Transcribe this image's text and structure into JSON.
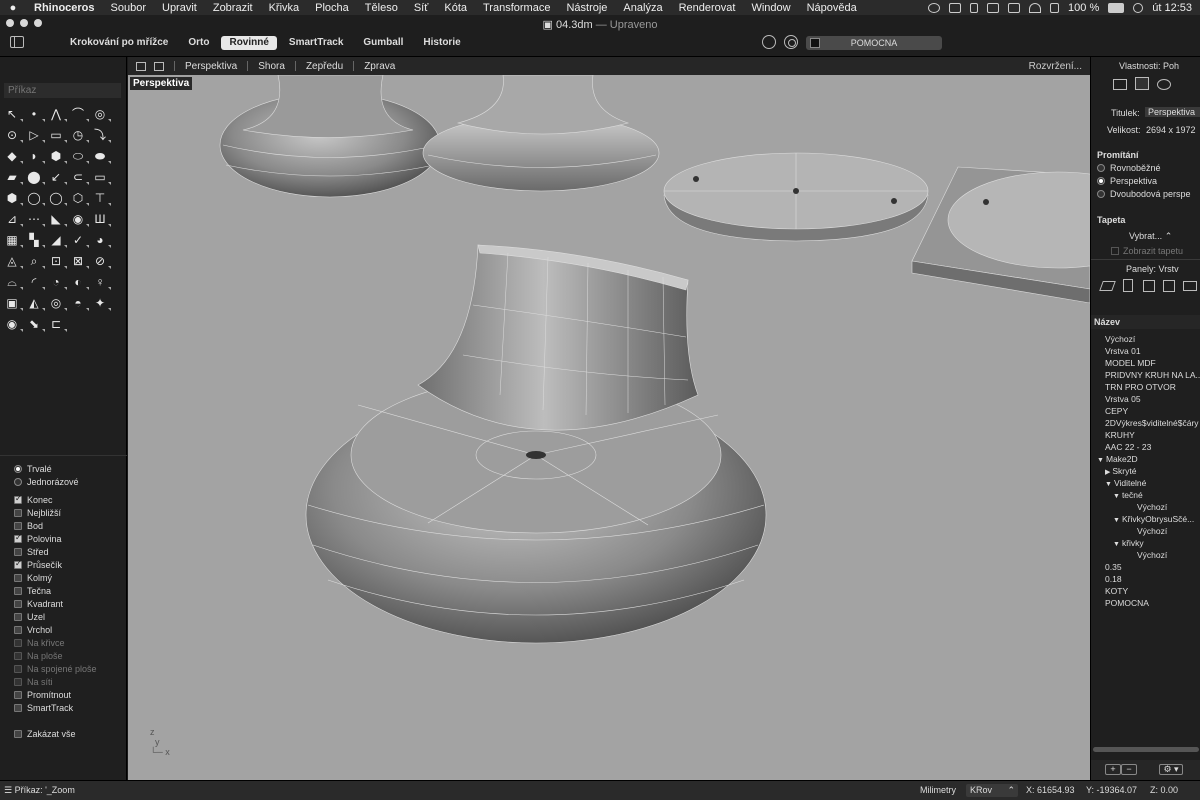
{
  "menubar": {
    "apple_icon": "apple-icon",
    "items": [
      "Rhinoceros",
      "Soubor",
      "Upravit",
      "Zobrazit",
      "Křivka",
      "Plocha",
      "Těleso",
      "Síť",
      "Kóta",
      "Transformace",
      "Nástroje",
      "Analýza",
      "Renderovat",
      "Window",
      "Nápověda"
    ],
    "battery": "100 %",
    "clock": "út 12:53"
  },
  "window": {
    "doc_name": "04.3dm",
    "doc_status": "— Upraveno"
  },
  "toolbar": {
    "modes": [
      {
        "label": "Krokování po mřížce",
        "active": false
      },
      {
        "label": "Orto",
        "active": false
      },
      {
        "label": "Rovinné",
        "active": true
      },
      {
        "label": "SmartTrack",
        "active": false
      },
      {
        "label": "Gumball",
        "active": false
      },
      {
        "label": "Historie",
        "active": false
      }
    ],
    "current_layer": "POMOCNA"
  },
  "viewbar": {
    "tabs": [
      "Perspektiva",
      "Shora",
      "Zepředu",
      "Zprava"
    ],
    "layout_label": "Rozvržení..."
  },
  "command": {
    "placeholder": "Příkaz"
  },
  "tools": [
    "↖",
    "•",
    "⋀",
    "⌒",
    "◎",
    "⊙",
    "▷",
    "▭",
    "◷",
    "⤵",
    "◆",
    "◗",
    "⬢",
    "⬭",
    "⬬",
    "▰",
    "⬤",
    "↙",
    "⊂",
    "▭",
    "⬢",
    "◯",
    "◯",
    "⬡",
    "⊤",
    "⊿",
    "⋯",
    "◣",
    "◉",
    "Ш",
    "▦",
    "▚",
    "◢",
    "✓",
    "◕",
    "◬",
    "⌕",
    "⊡",
    "⊠",
    "⊘",
    "⌓",
    "◜",
    "◔",
    "◐",
    "♀",
    "▣",
    "◭",
    "◎",
    "◓",
    "✦",
    "◉",
    "⬊",
    "⊏"
  ],
  "osnap": {
    "modes": [
      {
        "label": "Trvalé",
        "on": true
      },
      {
        "label": "Jednorázové",
        "on": false
      }
    ],
    "snaps": [
      {
        "label": "Konec",
        "on": true,
        "dim": false
      },
      {
        "label": "Nejbližší",
        "on": false,
        "dim": false
      },
      {
        "label": "Bod",
        "on": false,
        "dim": false
      },
      {
        "label": "Polovina",
        "on": true,
        "dim": false
      },
      {
        "label": "Střed",
        "on": false,
        "dim": false
      },
      {
        "label": "Průsečík",
        "on": true,
        "dim": false
      },
      {
        "label": "Kolmý",
        "on": false,
        "dim": false
      },
      {
        "label": "Tečna",
        "on": false,
        "dim": false
      },
      {
        "label": "Kvadrant",
        "on": false,
        "dim": false
      },
      {
        "label": "Uzel",
        "on": false,
        "dim": false
      },
      {
        "label": "Vrchol",
        "on": false,
        "dim": false
      },
      {
        "label": "Na křivce",
        "on": false,
        "dim": true
      },
      {
        "label": "Na ploše",
        "on": false,
        "dim": true
      },
      {
        "label": "Na spojené ploše",
        "on": false,
        "dim": true
      },
      {
        "label": "Na síti",
        "on": false,
        "dim": true
      },
      {
        "label": "Promítnout",
        "on": false,
        "dim": false
      },
      {
        "label": "SmartTrack",
        "on": false,
        "dim": false
      }
    ],
    "disable_all": "Zakázat vše"
  },
  "viewport": {
    "label": "Perspektiva",
    "bg": "#a3a3a3"
  },
  "properties": {
    "title": "Vlastnosti: Poh",
    "titulek_label": "Titulek:",
    "titulek_value": "Perspektiva",
    "velikost_label": "Velikost:",
    "velikost_value": "2694 x 1972",
    "promitani": "Promítání",
    "projections": [
      {
        "label": "Rovnoběžné",
        "on": false
      },
      {
        "label": "Perspektiva",
        "on": true
      },
      {
        "label": "Dvoubodová perspe",
        "on": false
      }
    ],
    "tapeta": "Tapeta",
    "vybrat": "Vybrat...",
    "zobrazit_tapetu": "Zobrazit tapetu"
  },
  "layers": {
    "panel_title": "Panely: Vrstv",
    "name_header": "Název",
    "items": [
      {
        "label": "Výchozí",
        "indent": 0,
        "arrow": ""
      },
      {
        "label": "Vrstva 01",
        "indent": 0,
        "arrow": ""
      },
      {
        "label": "MODEL MDF",
        "indent": 0,
        "arrow": ""
      },
      {
        "label": "PRIDVNY KRUH NA LA...",
        "indent": 0,
        "arrow": ""
      },
      {
        "label": "TRN PRO OTVOR",
        "indent": 0,
        "arrow": ""
      },
      {
        "label": "Vrstva 05",
        "indent": 0,
        "arrow": ""
      },
      {
        "label": "CEPY",
        "indent": 0,
        "arrow": ""
      },
      {
        "label": "2DVýkres$viditelné$čáry",
        "indent": 0,
        "arrow": ""
      },
      {
        "label": "KRUHY",
        "indent": 0,
        "arrow": ""
      },
      {
        "label": "AAC 22 - 23",
        "indent": 0,
        "arrow": ""
      },
      {
        "label": "Make2D",
        "indent": 0,
        "arrow": "▼"
      },
      {
        "label": "Skryté",
        "indent": 1,
        "arrow": "▶"
      },
      {
        "label": "Viditelné",
        "indent": 1,
        "arrow": "▼"
      },
      {
        "label": "tečné",
        "indent": 2,
        "arrow": "▼"
      },
      {
        "label": "Výchozí",
        "indent": 4,
        "arrow": ""
      },
      {
        "label": "KřivkyObrysuSčé...",
        "indent": 2,
        "arrow": "▼"
      },
      {
        "label": "Výchozí",
        "indent": 4,
        "arrow": ""
      },
      {
        "label": "křivky",
        "indent": 2,
        "arrow": "▼"
      },
      {
        "label": "Výchozí",
        "indent": 4,
        "arrow": ""
      },
      {
        "label": "0.35",
        "indent": 0,
        "arrow": ""
      },
      {
        "label": "0.18",
        "indent": 0,
        "arrow": ""
      },
      {
        "label": "KOTY",
        "indent": 0,
        "arrow": ""
      },
      {
        "label": "POMOCNA",
        "indent": 0,
        "arrow": ""
      }
    ]
  },
  "status": {
    "command_text": "Příkaz: '_Zoom",
    "units": "Milimetry",
    "layer": "KRov",
    "x": "X: 61654.93",
    "y": "Y: -19364.07",
    "z": "Z: 0.00"
  }
}
